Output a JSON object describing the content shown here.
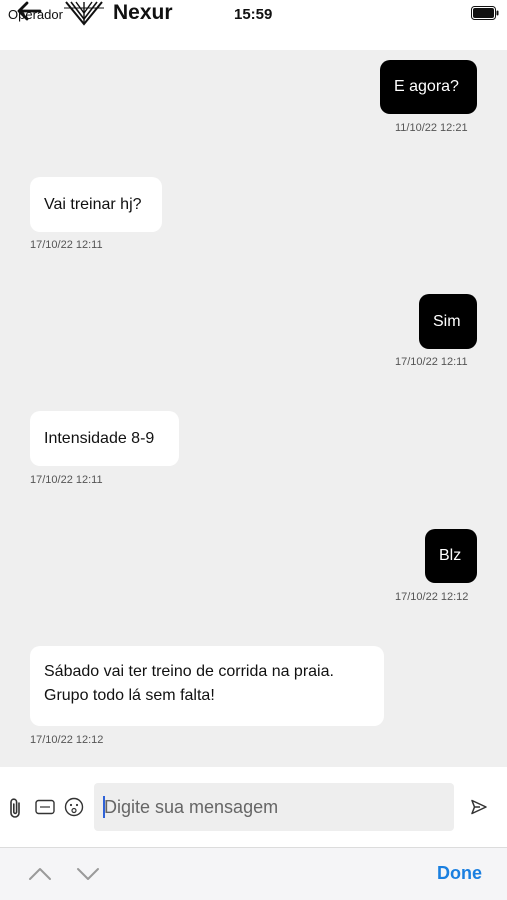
{
  "status_bar": {
    "carrier": "Operador",
    "time": "15:59"
  },
  "header": {
    "title": "Nexur"
  },
  "messages": [
    {
      "direction": "out",
      "text": "E agora?",
      "timestamp": "11/10/22 12:21"
    },
    {
      "direction": "in",
      "text": "Vai treinar hj?",
      "timestamp": "17/10/22 12:11"
    },
    {
      "direction": "out",
      "text": "Sim",
      "timestamp": "17/10/22 12:11"
    },
    {
      "direction": "in",
      "text": "Intensidade 8-9",
      "timestamp": "17/10/22 12:11"
    },
    {
      "direction": "out",
      "text": "Blz",
      "timestamp": "17/10/22 12:12"
    },
    {
      "direction": "in",
      "text_lines": [
        "Sábado vai ter treino de corrida na praia.",
        "Grupo todo lá sem falta!"
      ],
      "timestamp": "17/10/22 12:12"
    }
  ],
  "composer": {
    "placeholder": "Digite sua mensagem",
    "icons": [
      "paperclip-icon",
      "gif-icon",
      "emoji-icon",
      "send-icon"
    ]
  },
  "keyboard_accessory": {
    "done_label": "Done",
    "icons": [
      "chevron-up-icon",
      "chevron-down-icon"
    ]
  },
  "colors": {
    "outgoing_bubble": "#000000",
    "incoming_bubble": "#ffffff",
    "chat_background": "#efefef",
    "accent": "#1a7fe0"
  }
}
